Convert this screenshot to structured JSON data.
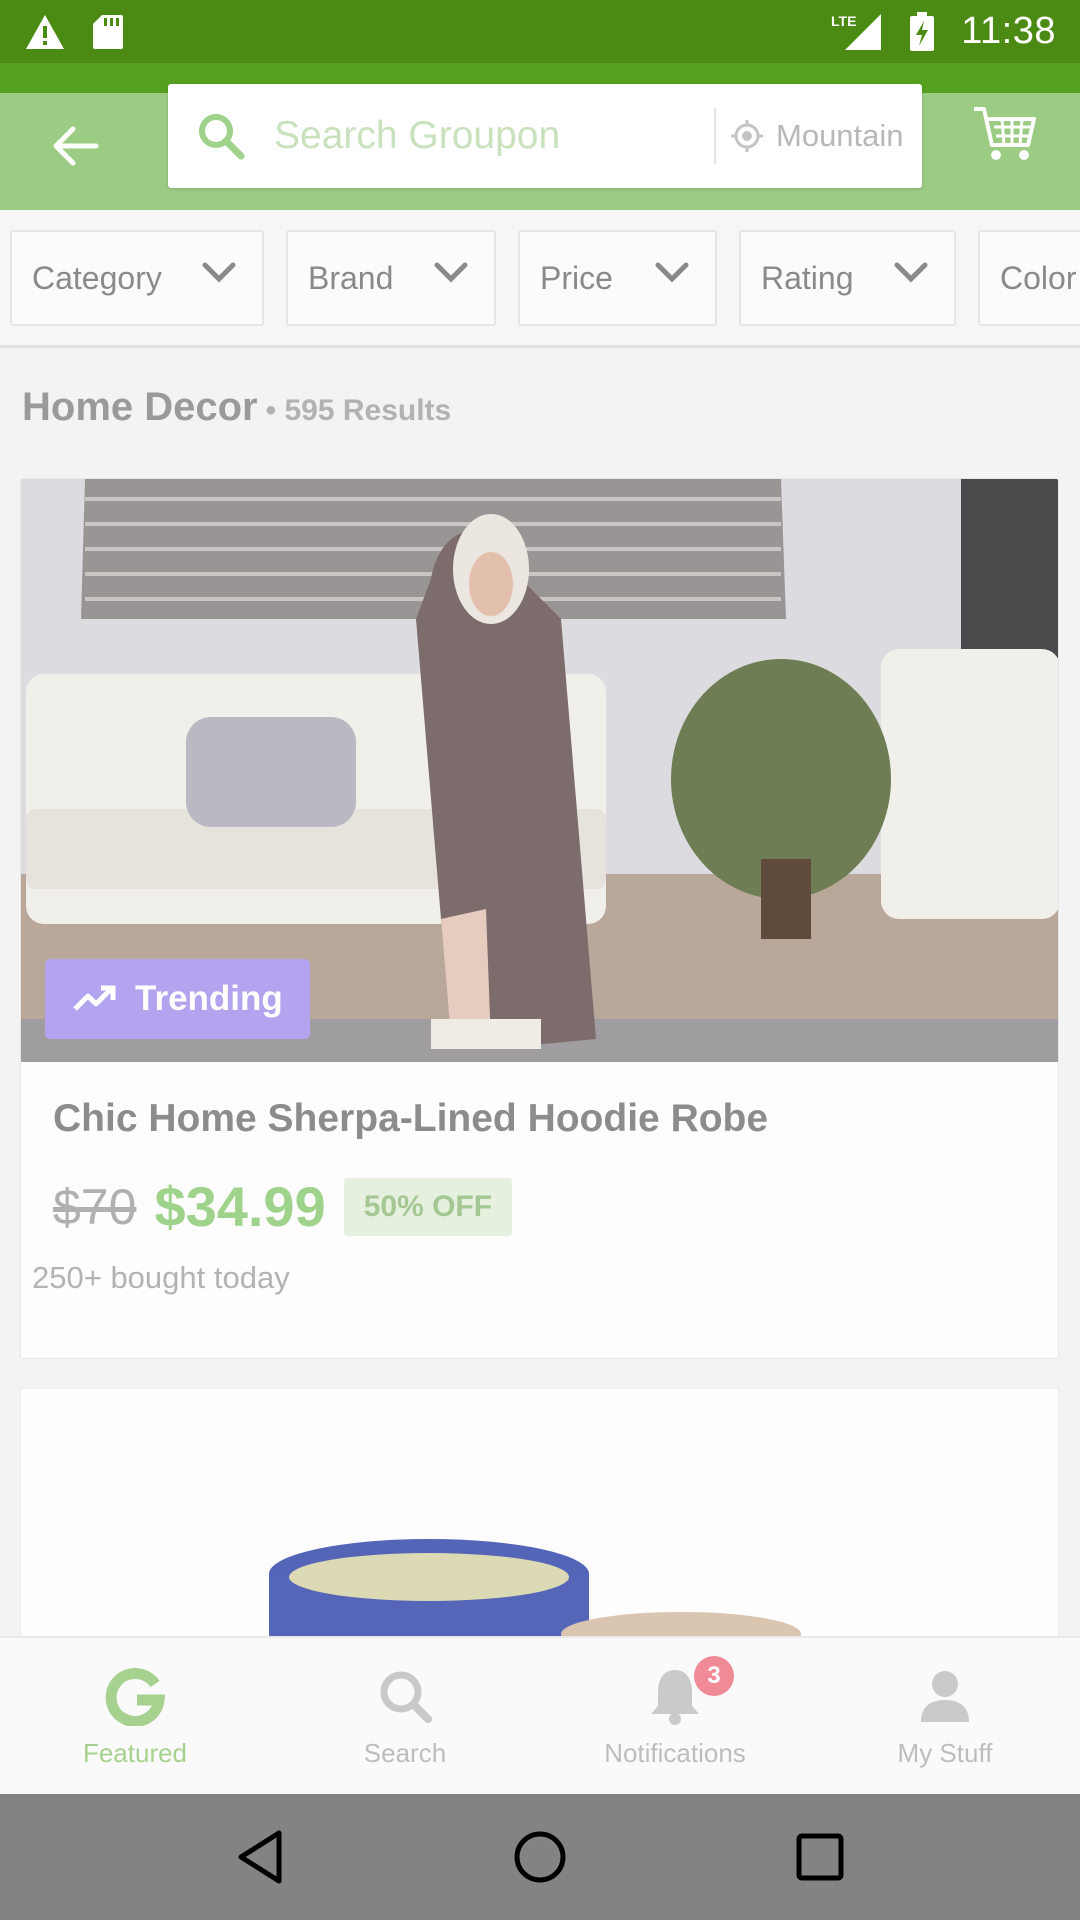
{
  "status_bar": {
    "time": "11:38",
    "network": "LTE",
    "icons": [
      "warning-icon",
      "sd-card-icon",
      "signal-icon",
      "battery-charging-icon"
    ]
  },
  "header": {
    "search_placeholder": "Search Groupon",
    "location": "Mountain View",
    "icons": [
      "back-arrow-icon",
      "search-icon",
      "location-target-icon",
      "cart-icon"
    ],
    "colors": {
      "status_bar": "#4b8b13",
      "header_bg": "#9ccb84",
      "accent_green": "#55a11f"
    }
  },
  "filters": [
    {
      "label": "Category"
    },
    {
      "label": "Brand"
    },
    {
      "label": "Price"
    },
    {
      "label": "Rating"
    },
    {
      "label": "Color"
    }
  ],
  "results": {
    "category": "Home Decor",
    "count_label": "• 595 Results"
  },
  "deal": {
    "badge": "Trending",
    "title": "Chic Home Sherpa-Lined Hoodie Robe",
    "old_price": "$70",
    "new_price": "$34.99",
    "discount": "50% OFF",
    "social_proof": "250+ bought today",
    "colors": {
      "price_green": "#9fd28a",
      "badge_purple": "#b4a4ef"
    }
  },
  "bottom_nav": {
    "items": [
      {
        "label": "Featured",
        "icon": "groupon-g-icon",
        "active": true
      },
      {
        "label": "Search",
        "icon": "search-icon",
        "active": false
      },
      {
        "label": "Notifications",
        "icon": "bell-icon",
        "active": false,
        "badge": "3"
      },
      {
        "label": "My Stuff",
        "icon": "person-icon",
        "active": false
      }
    ]
  },
  "system_nav": {
    "icons": [
      "back-triangle-icon",
      "home-circle-icon",
      "recents-square-icon"
    ]
  }
}
